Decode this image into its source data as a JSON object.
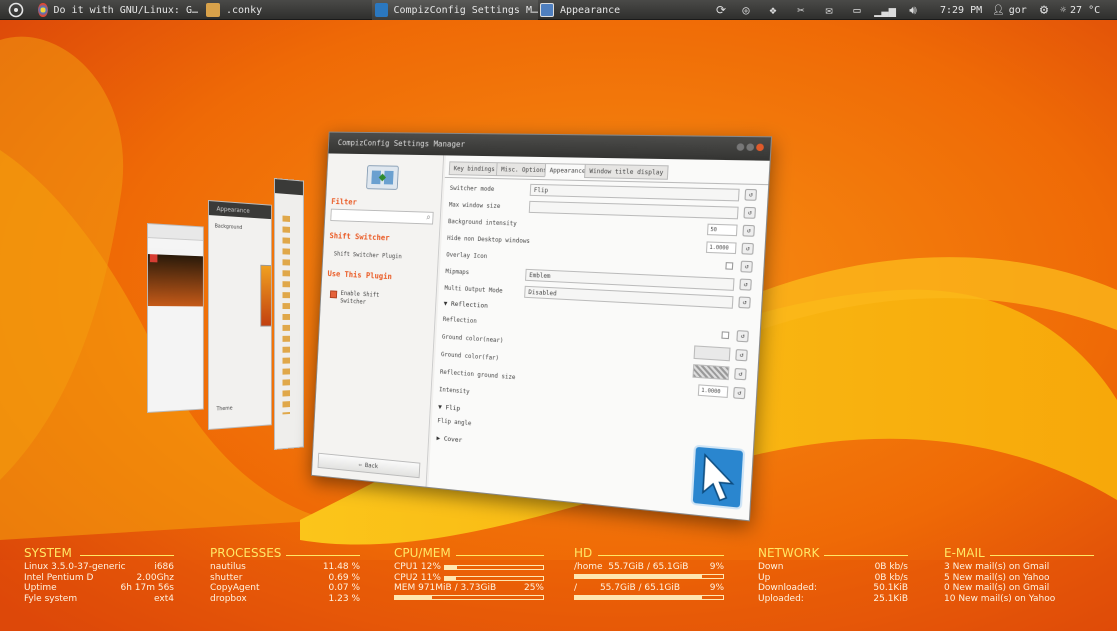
{
  "panel": {
    "tasks": [
      {
        "label": "Do it with GNU/Linux: G…",
        "icon": "browser-icon"
      },
      {
        "label": ".conky",
        "icon": "folder-icon"
      },
      {
        "label": "CompizConfig Settings M…",
        "icon": "ccsm-icon"
      },
      {
        "label": "Appearance",
        "icon": "appearance-icon"
      }
    ],
    "clock": "7:29 PM",
    "user": "gor",
    "weather": "27 °C"
  },
  "ccsm": {
    "title": "CompizConfig Settings Manager",
    "filter_label": "Filter",
    "plugin_heading": "Shift Switcher",
    "plugin_desc": "Shift Switcher Plugin",
    "use_heading": "Use This Plugin",
    "enable_label": "Enable Shift Switcher",
    "back_label": "Back",
    "tabs": [
      "Key bindings",
      "Misc. Options",
      "Appearance",
      "Window title display"
    ],
    "options": [
      {
        "label": "Switcher mode",
        "kind": "combo",
        "value": "Flip"
      },
      {
        "label": "Max window size",
        "kind": "combo",
        "value": ""
      },
      {
        "label": "Background intensity",
        "kind": "spin",
        "value": "50"
      },
      {
        "label": "Hide non Desktop windows",
        "kind": "spin",
        "value": "1.0000"
      },
      {
        "label": "Overlay Icon",
        "kind": "check",
        "value": ""
      },
      {
        "label": "Mipmaps",
        "kind": "combo",
        "value": "Emblem"
      },
      {
        "label": "Multi Output Mode",
        "kind": "combo",
        "value": "Disabled"
      }
    ],
    "section_reflection": "Reflection",
    "reflection_options": [
      {
        "label": "Reflection",
        "kind": "check"
      },
      {
        "label": "Ground color(near)",
        "kind": "swatch"
      },
      {
        "label": "Ground color(far)",
        "kind": "swatch"
      },
      {
        "label": "Reflection ground size",
        "kind": "spin",
        "value": "1.0000"
      },
      {
        "label": "Intensity",
        "kind": "none"
      }
    ],
    "section_flip": "Flip",
    "flip_angle": "Flip angle",
    "section_cover": "Cover"
  },
  "bg_windows": {
    "appearance_title": "Appearance",
    "appearance_tab": "Background",
    "appearance_theme": "Theme"
  },
  "conky": {
    "system": {
      "title": "SYSTEM",
      "rows": [
        {
          "k": "Linux 3.5.0-37-generic",
          "v": "i686"
        },
        {
          "k": "Intel Pentium D",
          "v": "2.00Ghz"
        },
        {
          "k": "Uptime",
          "v": "6h 17m 56s"
        },
        {
          "k": "Fyle system",
          "v": "ext4"
        }
      ]
    },
    "processes": {
      "title": "PROCESSES",
      "rows": [
        {
          "k": "nautilus",
          "v": "11.48 %"
        },
        {
          "k": "shutter",
          "v": "0.69 %"
        },
        {
          "k": "CopyAgent",
          "v": "0.07 %"
        },
        {
          "k": "dropbox",
          "v": "1.23 %"
        }
      ]
    },
    "cpumem": {
      "title": "CPU/MEM",
      "rows": [
        {
          "k": "CPU1",
          "v": "12%",
          "fill": 0.12
        },
        {
          "k": "CPU2",
          "v": "11%",
          "fill": 0.11
        },
        {
          "k": "MEM",
          "mid": "971MiB / 3.73GiB",
          "v": "25%",
          "fill": 0.25
        }
      ]
    },
    "hd": {
      "title": "HD",
      "rows": [
        {
          "k": "/home",
          "mid": "55.7GiB / 65.1GiB",
          "v": "9%",
          "fill": 0.86
        },
        {
          "k": "/",
          "mid": "55.7GiB / 65.1GiB",
          "v": "9%",
          "fill": 0.86
        }
      ]
    },
    "network": {
      "title": "NETWORK",
      "rows": [
        {
          "k": "Down",
          "v": "0B kb/s"
        },
        {
          "k": "Up",
          "v": "0B kb/s"
        },
        {
          "k": "Downloaded:",
          "v": "50.1KiB"
        },
        {
          "k": "Uploaded:",
          "v": "25.1KiB"
        }
      ]
    },
    "email": {
      "title": "E-MAIL",
      "rows": [
        {
          "k": "3 New mail(s) on Gmail"
        },
        {
          "k": "5 New mail(s) on Yahoo"
        },
        {
          "k": "0 New mail(s) on Gmail"
        },
        {
          "k": "10 New mail(s) on Yahoo"
        }
      ]
    }
  }
}
